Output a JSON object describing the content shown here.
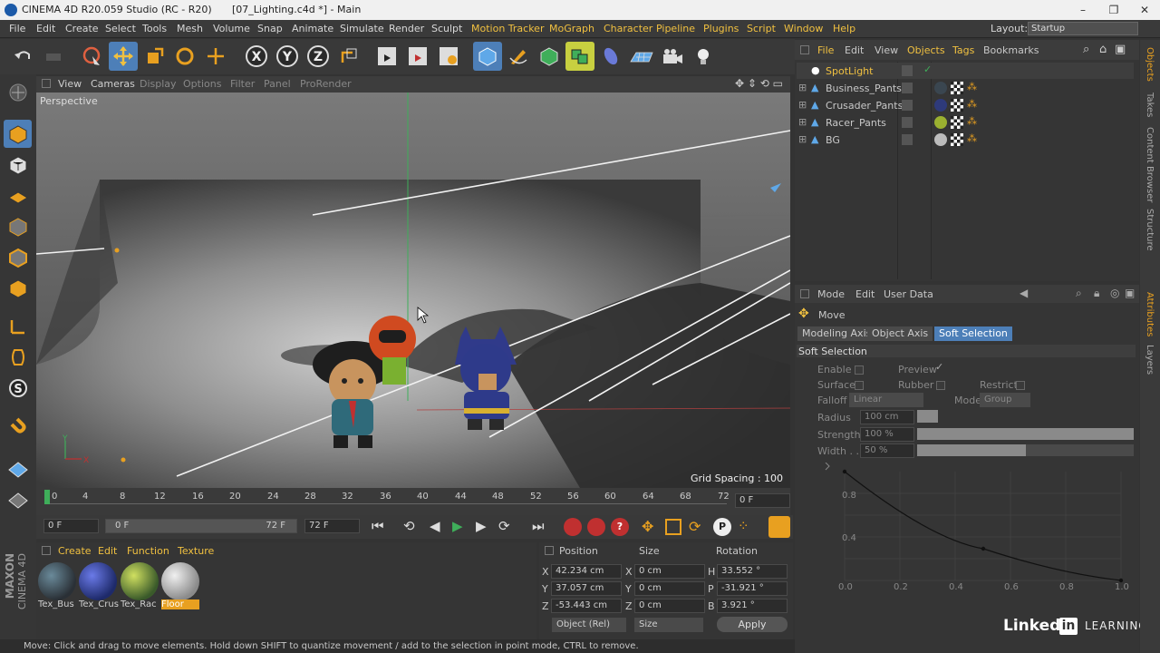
{
  "window": {
    "title": "CINEMA 4D R20.059 Studio (RC - R20)",
    "doc": "[07_Lighting.c4d *] - Main"
  },
  "menu": [
    "File",
    "Edit",
    "Create",
    "Select",
    "Tools",
    "Mesh",
    "Volume",
    "Snap",
    "Animate",
    "Simulate",
    "Render",
    "Sculpt",
    "Motion Tracker",
    "MoGraph",
    "Character",
    "Pipeline",
    "Plugins",
    "Script",
    "Window",
    "Help"
  ],
  "layout": {
    "label": "Layout:",
    "value": "Startup"
  },
  "viewport": {
    "menu": [
      "View",
      "Cameras",
      "Display",
      "Options",
      "Filter",
      "Panel",
      "ProRender"
    ],
    "name": "Perspective",
    "grid": "Grid Spacing : 100 cm"
  },
  "timeline": {
    "ticks": [
      "0",
      "4",
      "8",
      "12",
      "16",
      "20",
      "24",
      "28",
      "32",
      "36",
      "40",
      "44",
      "48",
      "52",
      "56",
      "60",
      "64",
      "68",
      "72"
    ],
    "frame_field": "0 F"
  },
  "transport": {
    "start": "0 F",
    "range_start": "0 F",
    "range_end": "72 F",
    "end": "72 F"
  },
  "materials": {
    "menu": [
      "Create",
      "Edit",
      "Function",
      "Texture"
    ],
    "items": [
      {
        "name": "Tex_Bus",
        "color": "#3a4650"
      },
      {
        "name": "Tex_Crus",
        "color": "#2e3a7a"
      },
      {
        "name": "Tex_Rac",
        "color": "#7a9a3a"
      },
      {
        "name": "Floor",
        "color": "#bcbcbc"
      }
    ]
  },
  "coords": {
    "headers": [
      "Position",
      "Size",
      "Rotation"
    ],
    "rows": [
      {
        "a": "X",
        "pos": "42.234 cm",
        "b": "X",
        "size": "0 cm",
        "c": "H",
        "rot": "33.552 °"
      },
      {
        "a": "Y",
        "pos": "37.057 cm",
        "b": "Y",
        "size": "0 cm",
        "c": "P",
        "rot": "-31.921 °"
      },
      {
        "a": "Z",
        "pos": "-53.443 cm",
        "b": "Z",
        "size": "0 cm",
        "c": "B",
        "rot": "3.921 °"
      }
    ],
    "mode": "Object (Rel)",
    "sizemode": "Size",
    "apply": "Apply"
  },
  "objects": {
    "menu": [
      "File",
      "Edit",
      "View",
      "Objects",
      "Tags",
      "Bookmarks"
    ],
    "items": [
      "SpotLight",
      "Business_Pants",
      "Crusader_Pants",
      "Racer_Pants",
      "BG"
    ]
  },
  "attributes": {
    "menu": [
      "Mode",
      "Edit",
      "User Data"
    ],
    "tool": "Move",
    "tabs": [
      "Modeling Axis",
      "Object Axis",
      "Soft Selection"
    ],
    "section": "Soft Selection",
    "enable": "Enable",
    "preview": "Preview",
    "surface": "Surface",
    "rubber": "Rubber",
    "restrict": "Restrict",
    "falloff": "Falloff",
    "falloff_val": "Linear",
    "mode": "Mode",
    "mode_val": "Group",
    "radius": "Radius",
    "radius_val": "100 cm",
    "strength": "Strength",
    "strength_val": "100 %",
    "width": "Width . .",
    "width_val": "50 %",
    "strength_level": 1.0,
    "width_level": 0.5,
    "graph_x": [
      "0.0",
      "0.2",
      "0.4",
      "0.6",
      "0.8",
      "1.0"
    ],
    "graph_y": [
      "0.8",
      "0.4"
    ]
  },
  "rightstrip": [
    "Objects",
    "Takes",
    "Content Browser",
    "Structure"
  ],
  "rightstrip2": [
    "Attributes",
    "Layers"
  ],
  "status": "Move: Click and drag to move elements. Hold down SHIFT to quantize movement / add to the selection in point mode, CTRL to remove.",
  "brand": {
    "maxon": "MAXON",
    "c4d": "CINEMA 4D",
    "linkedin": "Linked",
    "learning": "LEARNING"
  }
}
